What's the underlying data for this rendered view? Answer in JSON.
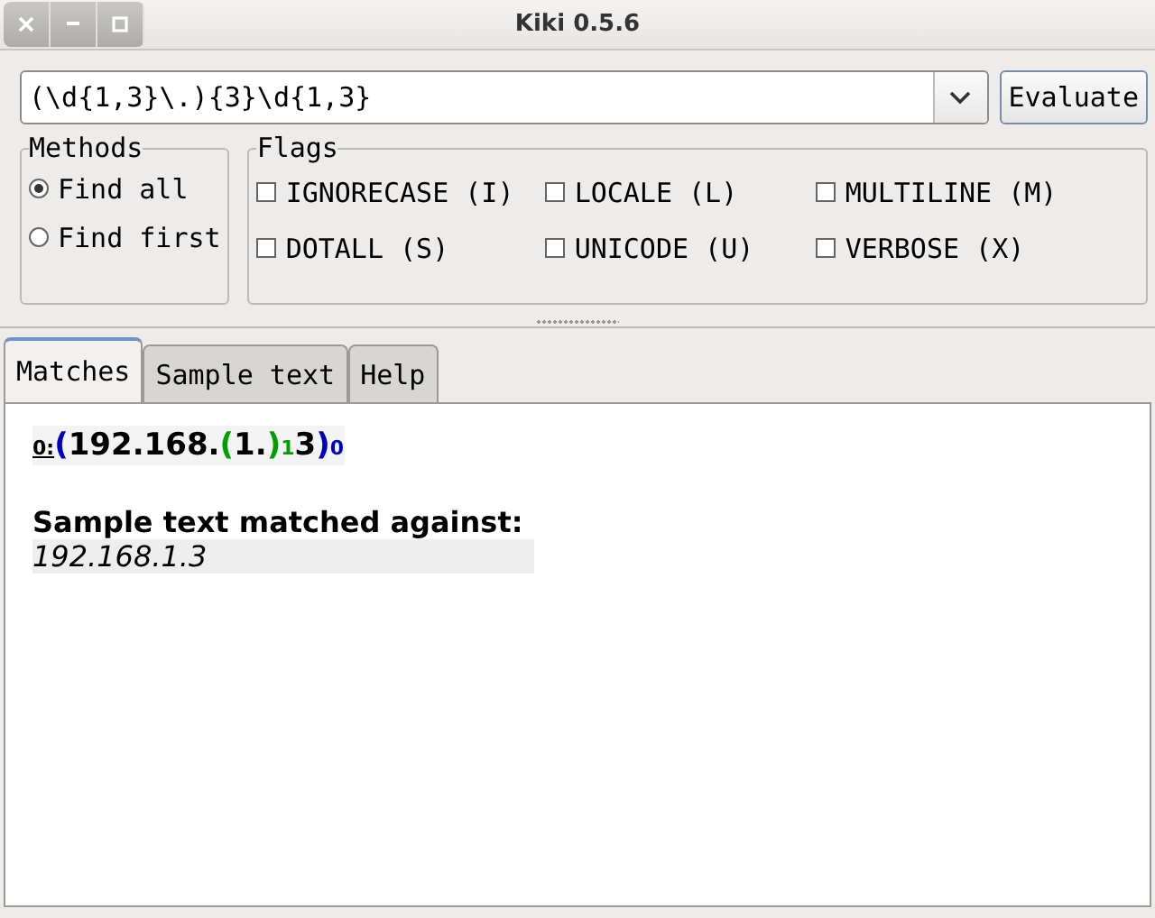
{
  "window": {
    "title": "Kiki 0.5.6"
  },
  "regex": {
    "value": "(\\d{1,3}\\.){3}\\d{1,3}"
  },
  "evaluate_button": "Evaluate",
  "methods": {
    "title": "Methods",
    "options": [
      {
        "label": "Find all",
        "selected": true
      },
      {
        "label": "Find first",
        "selected": false
      }
    ]
  },
  "flags": {
    "title": "Flags",
    "items": [
      {
        "label": "IGNORECASE (I)",
        "checked": false
      },
      {
        "label": "LOCALE (L)",
        "checked": false
      },
      {
        "label": "MULTILINE (M)",
        "checked": false
      },
      {
        "label": "DOTALL (S)",
        "checked": false
      },
      {
        "label": "UNICODE (U)",
        "checked": false
      },
      {
        "label": "VERBOSE (X)",
        "checked": false
      }
    ]
  },
  "tabs": [
    {
      "label": "Matches",
      "selected": true
    },
    {
      "label": "Sample text",
      "selected": false
    },
    {
      "label": "Help",
      "selected": false
    }
  ],
  "match": [
    {
      "kind": "label",
      "text": "0:"
    },
    {
      "kind": "paren",
      "text": "(",
      "color": "#0000c0"
    },
    {
      "kind": "text",
      "text": "192.168."
    },
    {
      "kind": "paren",
      "text": "(",
      "color": "#00a000"
    },
    {
      "kind": "text",
      "text": "1."
    },
    {
      "kind": "paren",
      "text": ")",
      "color": "#00a000"
    },
    {
      "kind": "index",
      "text": "1",
      "color": "#00a000"
    },
    {
      "kind": "text",
      "text": "3"
    },
    {
      "kind": "paren",
      "text": ")",
      "color": "#0000c0"
    },
    {
      "kind": "index",
      "text": "0",
      "color": "#0000c0"
    }
  ],
  "sample_heading": "Sample text matched against:",
  "sample_text": "192.168.1.3"
}
